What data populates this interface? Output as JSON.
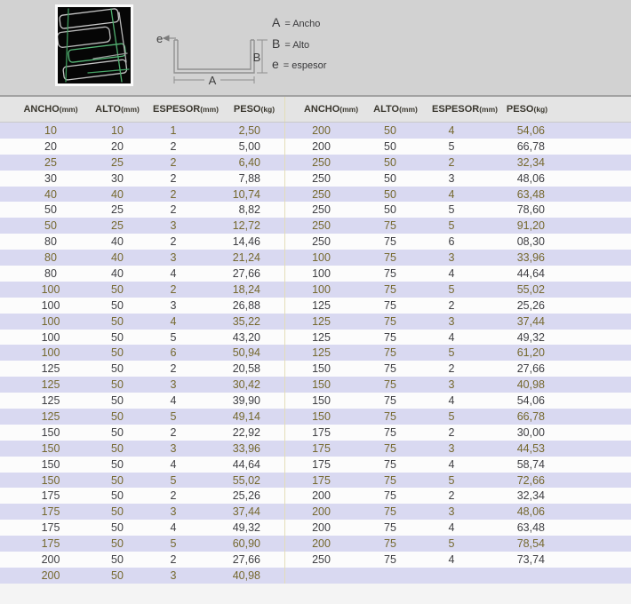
{
  "top": {
    "photo_alt": "channel-profiles-photo",
    "diagram": {
      "label_a": "A",
      "label_b": "B",
      "label_e": "e"
    },
    "legend": {
      "items": [
        {
          "symbol": "A",
          "text": "= Ancho"
        },
        {
          "symbol": "B",
          "text": "= Alto"
        },
        {
          "symbol": "e",
          "text": "= espesor"
        }
      ]
    }
  },
  "table": {
    "headers": {
      "ancho": "ANCHO",
      "alto": "ALTO",
      "espesor": "ESPESOR",
      "peso": "PESO",
      "unit_mm": "(mm)",
      "unit_kg": "(kg)"
    },
    "left_rows": [
      [
        "10",
        "10",
        "1",
        "2,50"
      ],
      [
        "20",
        "20",
        "2",
        "5,00"
      ],
      [
        "25",
        "25",
        "2",
        "6,40"
      ],
      [
        "30",
        "30",
        "2",
        "7,88"
      ],
      [
        "40",
        "40",
        "2",
        "10,74"
      ],
      [
        "50",
        "25",
        "2",
        "8,82"
      ],
      [
        "50",
        "25",
        "3",
        "12,72"
      ],
      [
        "80",
        "40",
        "2",
        "14,46"
      ],
      [
        "80",
        "40",
        "3",
        "21,24"
      ],
      [
        "80",
        "40",
        "4",
        "27,66"
      ],
      [
        "100",
        "50",
        "2",
        "18,24"
      ],
      [
        "100",
        "50",
        "3",
        "26,88"
      ],
      [
        "100",
        "50",
        "4",
        "35,22"
      ],
      [
        "100",
        "50",
        "5",
        "43,20"
      ],
      [
        "100",
        "50",
        "6",
        "50,94"
      ],
      [
        "125",
        "50",
        "2",
        "20,58"
      ],
      [
        "125",
        "50",
        "3",
        "30,42"
      ],
      [
        "125",
        "50",
        "4",
        "39,90"
      ],
      [
        "125",
        "50",
        "5",
        "49,14"
      ],
      [
        "150",
        "50",
        "2",
        "22,92"
      ],
      [
        "150",
        "50",
        "3",
        "33,96"
      ],
      [
        "150",
        "50",
        "4",
        "44,64"
      ],
      [
        "150",
        "50",
        "5",
        "55,02"
      ],
      [
        "175",
        "50",
        "2",
        "25,26"
      ],
      [
        "175",
        "50",
        "3",
        "37,44"
      ],
      [
        "175",
        "50",
        "4",
        "49,32"
      ],
      [
        "175",
        "50",
        "5",
        "60,90"
      ],
      [
        "200",
        "50",
        "2",
        "27,66"
      ],
      [
        "200",
        "50",
        "3",
        "40,98"
      ]
    ],
    "right_rows": [
      [
        "200",
        "50",
        "4",
        "54,06"
      ],
      [
        "200",
        "50",
        "5",
        "66,78"
      ],
      [
        "250",
        "50",
        "2",
        "32,34"
      ],
      [
        "250",
        "50",
        "3",
        "48,06"
      ],
      [
        "250",
        "50",
        "4",
        "63,48"
      ],
      [
        "250",
        "50",
        "5",
        "78,60"
      ],
      [
        "250",
        "75",
        "5",
        "91,20"
      ],
      [
        "250",
        "75",
        "6",
        "08,30"
      ],
      [
        "100",
        "75",
        "3",
        "33,96"
      ],
      [
        "100",
        "75",
        "4",
        "44,64"
      ],
      [
        "100",
        "75",
        "5",
        "55,02"
      ],
      [
        "125",
        "75",
        "2",
        "25,26"
      ],
      [
        "125",
        "75",
        "3",
        "37,44"
      ],
      [
        "125",
        "75",
        "4",
        "49,32"
      ],
      [
        "125",
        "75",
        "5",
        "61,20"
      ],
      [
        "150",
        "75",
        "2",
        "27,66"
      ],
      [
        "150",
        "75",
        "3",
        "40,98"
      ],
      [
        "150",
        "75",
        "4",
        "54,06"
      ],
      [
        "150",
        "75",
        "5",
        "66,78"
      ],
      [
        "175",
        "75",
        "2",
        "30,00"
      ],
      [
        "175",
        "75",
        "3",
        "44,53"
      ],
      [
        "175",
        "75",
        "4",
        "58,74"
      ],
      [
        "175",
        "75",
        "5",
        "72,66"
      ],
      [
        "200",
        "75",
        "2",
        "32,34"
      ],
      [
        "200",
        "75",
        "3",
        "48,06"
      ],
      [
        "200",
        "75",
        "4",
        "63,48"
      ],
      [
        "200",
        "75",
        "5",
        "78,54"
      ],
      [
        "250",
        "75",
        "4",
        "73,74"
      ]
    ]
  },
  "colors": {
    "page_bg": "#d2d2d2",
    "header_bg": "#e4e4e4",
    "stripe": "#d9d9f1",
    "stripe_text": "#75682e",
    "row_text": "#3e3e42",
    "divider": "#e3ddb9",
    "photo_green": "#52b274",
    "photo_line": "#c9c9c9"
  }
}
